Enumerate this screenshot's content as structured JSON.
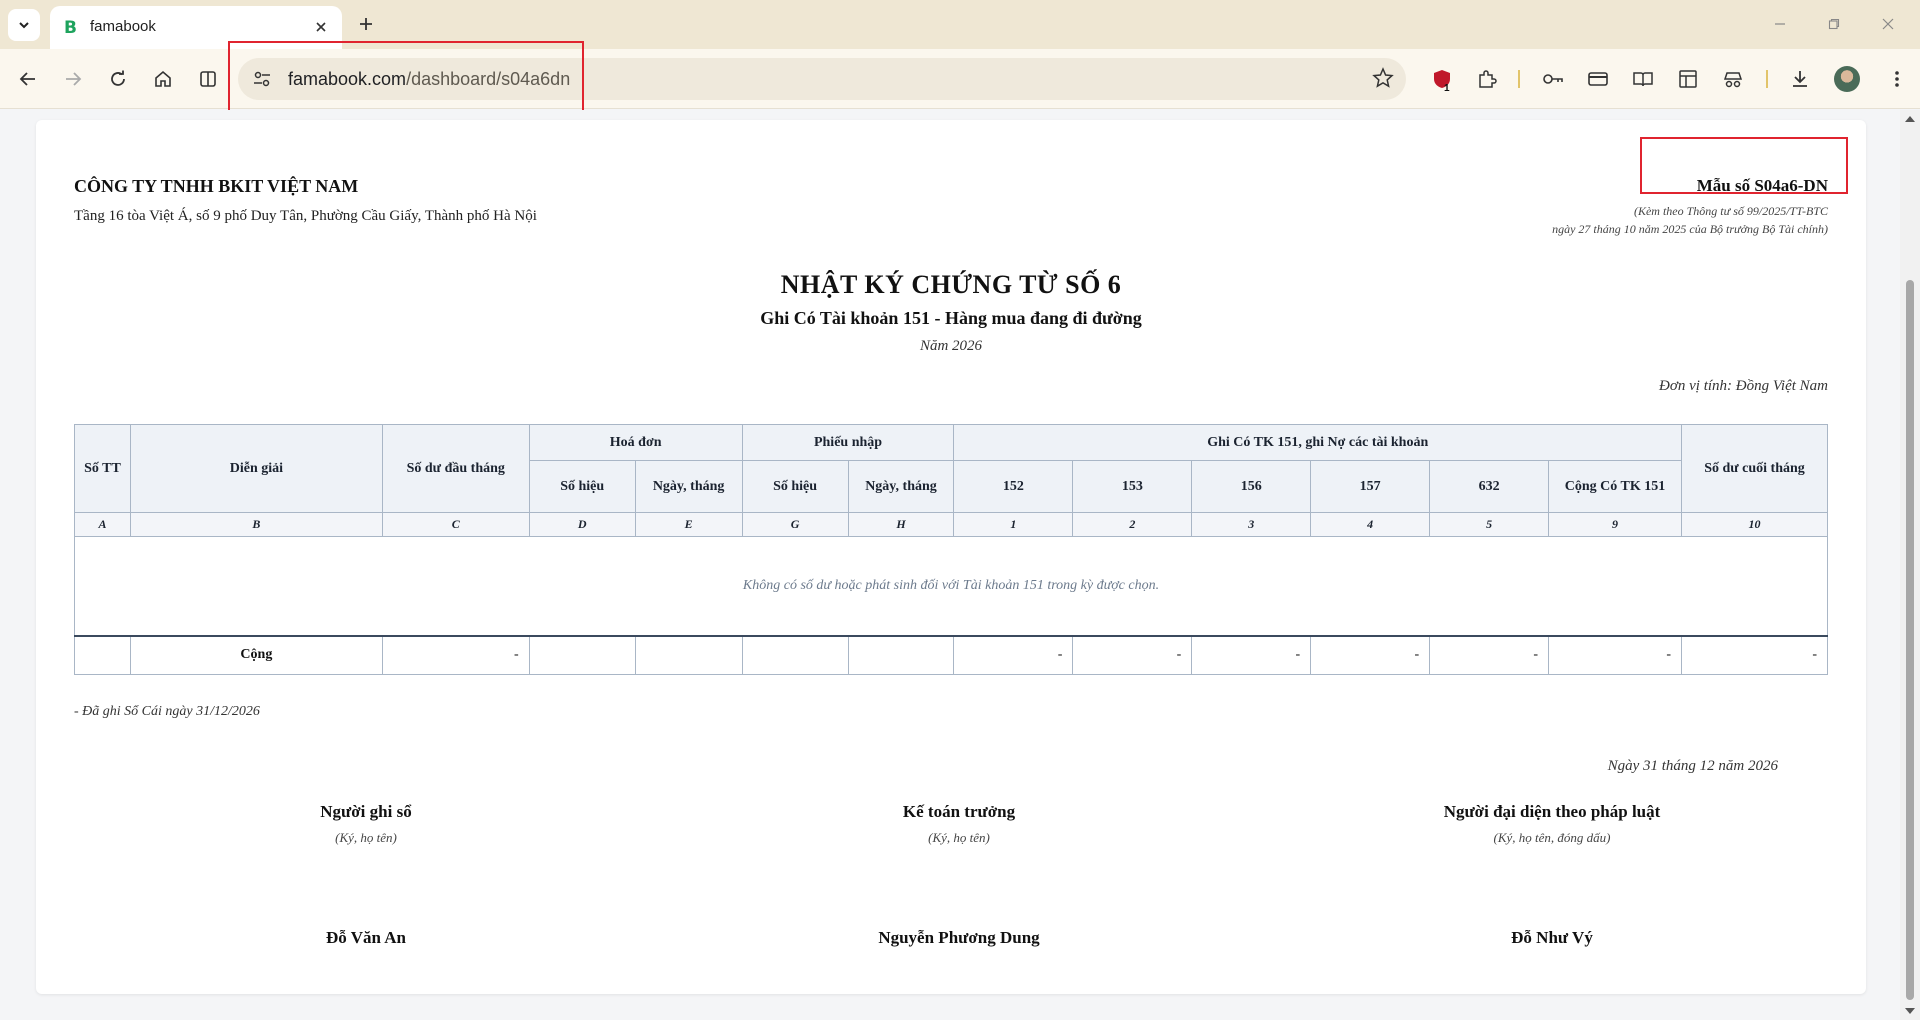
{
  "browser": {
    "tab_title": "famabook",
    "tab_favicon_letter": "B",
    "url_host": "famabook.com",
    "url_path": "/dashboard/s04a6dn",
    "extension_badge": "1",
    "accent_color": "#e0242f"
  },
  "report": {
    "company": "CÔNG TY TNHH BKIT VIỆT NAM",
    "address": "Tầng 16 tòa Việt Á, số 9 phố Duy Tân, Phường Cầu Giấy, Thành phố Hà Nội",
    "form_no": "Mẫu số S04a6-DN",
    "form_note_1": "(Kèm theo Thông tư số 99/2025/TT-BTC",
    "form_note_2": "ngày 27 tháng 10 năm 2025 của Bộ trưởng Bộ Tài chính)",
    "title": "NHẬT KÝ CHỨNG TỪ SỐ 6",
    "subtitle": "Ghi Có Tài khoản 151 - Hàng mua đang đi đường",
    "year": "Năm 2026",
    "unit": "Đơn vị tính: Đồng Việt Nam"
  },
  "table": {
    "h_stt": "Số TT",
    "h_dien_giai": "Diễn giải",
    "h_so_du_dau": "Số dư đầu tháng",
    "h_hoa_don": "Hoá đơn",
    "h_phieu_nhap": "Phiếu nhập",
    "h_ghi_co": "Ghi Có TK 151, ghi Nợ các tài khoản",
    "h_so_du_cuoi": "Số dư cuối tháng",
    "h_so_hieu_1": "Số hiệu",
    "h_ngay_thang_1": "Ngày, tháng",
    "h_so_hieu_2": "Số hiệu",
    "h_ngay_thang_2": "Ngày, tháng",
    "h_152": "152",
    "h_153": "153",
    "h_156": "156",
    "h_157": "157",
    "h_632": "632",
    "h_cong_co": "Cộng Có TK 151",
    "codes": [
      "A",
      "B",
      "C",
      "D",
      "E",
      "G",
      "H",
      "1",
      "2",
      "3",
      "4",
      "5",
      "9",
      "10"
    ],
    "empty_message": "Không có số dư hoặc phát sinh đối với Tài khoản 151 trong kỳ được chọn.",
    "total_label": "Cộng",
    "totals": [
      "",
      "-",
      "",
      "",
      "",
      "",
      "-",
      "-",
      "-",
      "-",
      "-",
      "-",
      "-"
    ]
  },
  "footer": {
    "ledger_note": "- Đã ghi Sổ Cái ngày 31/12/2026",
    "sign_date": "Ngày 31 tháng 12 năm 2026",
    "signers": [
      {
        "role": "Người ghi sổ",
        "hint": "(Ký, họ tên)",
        "name": "Đỗ Văn An"
      },
      {
        "role": "Kế toán trưởng",
        "hint": "(Ký, họ tên)",
        "name": "Nguyễn Phương Dung"
      },
      {
        "role": "Người đại diện theo pháp luật",
        "hint": "(Ký, họ tên, đóng dấu)",
        "name": "Đỗ Như Vý"
      }
    ]
  }
}
